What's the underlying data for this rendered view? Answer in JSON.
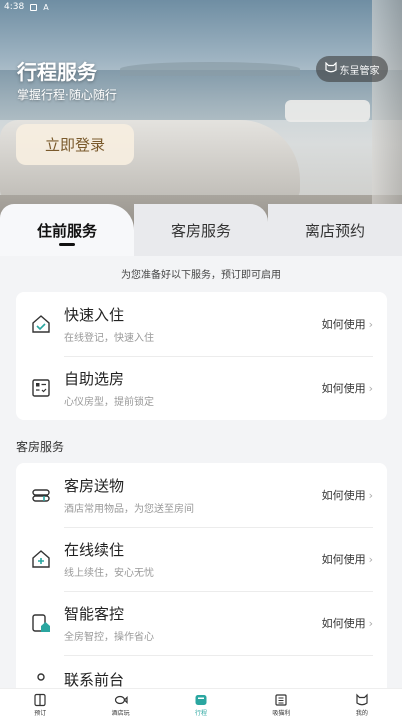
{
  "status_bar": {
    "time": "4:38",
    "indicator": "A"
  },
  "hero": {
    "title": "行程服务",
    "subtitle": "掌握行程·随心随行",
    "login_label": "立即登录",
    "butler_label": "东呈管家"
  },
  "tabs": [
    {
      "label": "住前服务",
      "active": true
    },
    {
      "label": "客房服务",
      "active": false
    },
    {
      "label": "离店预约",
      "active": false
    }
  ],
  "notice": "为您准备好以下服务，预订即可启用",
  "pre_stay": {
    "items": [
      {
        "title": "快速入住",
        "desc": "在线登记，快速入住",
        "action": "如何使用",
        "icon": "door-check-icon"
      },
      {
        "title": "自助选房",
        "desc": "心仪房型，提前锁定",
        "action": "如何使用",
        "icon": "room-grid-icon"
      }
    ]
  },
  "room_service": {
    "section_title": "客房服务",
    "items": [
      {
        "title": "客房送物",
        "desc": "酒店常用物品，为您送至房间",
        "action": "如何使用",
        "icon": "towel-stack-icon"
      },
      {
        "title": "在线续住",
        "desc": "线上续住，安心无忧",
        "action": "如何使用",
        "icon": "house-plus-icon"
      },
      {
        "title": "智能客控",
        "desc": "全房智控，操作省心",
        "action": "如何使用",
        "icon": "smart-home-icon"
      },
      {
        "title": "联系前台",
        "desc": "",
        "action": "",
        "icon": "contact-icon"
      }
    ]
  },
  "bottom_nav": [
    {
      "label": "预订",
      "icon": "book-icon",
      "active": false
    },
    {
      "label": "酒店玩",
      "icon": "fish-icon",
      "active": false
    },
    {
      "label": "行程",
      "icon": "trip-icon",
      "active": true
    },
    {
      "label": "吸猫利",
      "icon": "gift-box-icon",
      "active": false
    },
    {
      "label": "我的",
      "icon": "cat-face-icon",
      "active": false
    }
  ],
  "colors": {
    "accent": "#2aa6a0",
    "login_text": "#7a5a2c",
    "login_bg": "#f6eee0"
  }
}
